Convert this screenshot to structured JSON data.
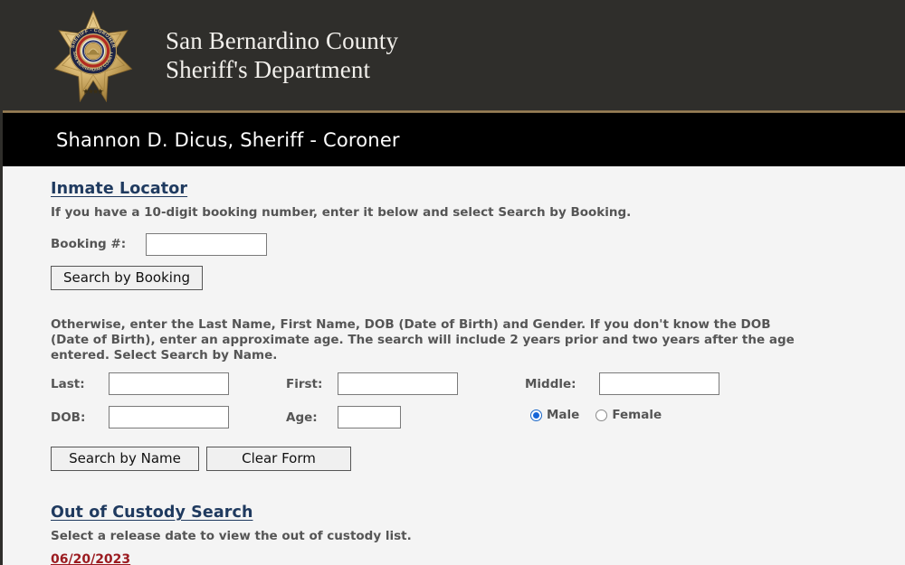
{
  "header": {
    "badge_icon": "sheriff-star-badge-icon",
    "badge_text": {
      "top_arc": "SHERIFF · CORONER",
      "bottom_arc": "SAN BERNARDINO COUNTY"
    },
    "agency_line1": "San Bernardino County",
    "agency_line2": "Sheriff's Department",
    "sheriff_name": "Shannon D. Dicus, Sheriff - Coroner",
    "colors": {
      "masthead_bg": "#2F2E2B",
      "gold_rule": "#A58A5E",
      "name_band_bg": "#000000",
      "page_bg": "#F4F4F4"
    }
  },
  "inmate_locator": {
    "heading": "Inmate Locator",
    "booking_instruction": "If you have a 10-digit booking number, enter it below and select Search by Booking.",
    "booking_label": "Booking #:",
    "booking_value": "",
    "booking_placeholder": "",
    "search_by_booking_label": "Search by Booking",
    "name_instruction": "Otherwise, enter the Last Name, First Name, DOB (Date of Birth) and Gender.  If you don't know the DOB (Date of Birth), enter an approximate age.  The search will include 2 years prior and two years after the age entered.  Select Search by Name.",
    "fields": {
      "last_label": "Last:",
      "last_value": "",
      "first_label": "First:",
      "first_value": "",
      "middle_label": "Middle:",
      "middle_value": "",
      "dob_label": "DOB:",
      "dob_value": "",
      "age_label": "Age:",
      "age_value": ""
    },
    "gender": {
      "male_label": "Male",
      "female_label": "Female",
      "selected": "Male"
    },
    "search_by_name_label": "Search by Name",
    "clear_form_label": "Clear Form"
  },
  "out_of_custody": {
    "heading": "Out of Custody Search",
    "instruction": "Select a release date to view the out of custody list.",
    "dates": [
      "06/20/2023"
    ],
    "date_color": "#9B1B20"
  }
}
